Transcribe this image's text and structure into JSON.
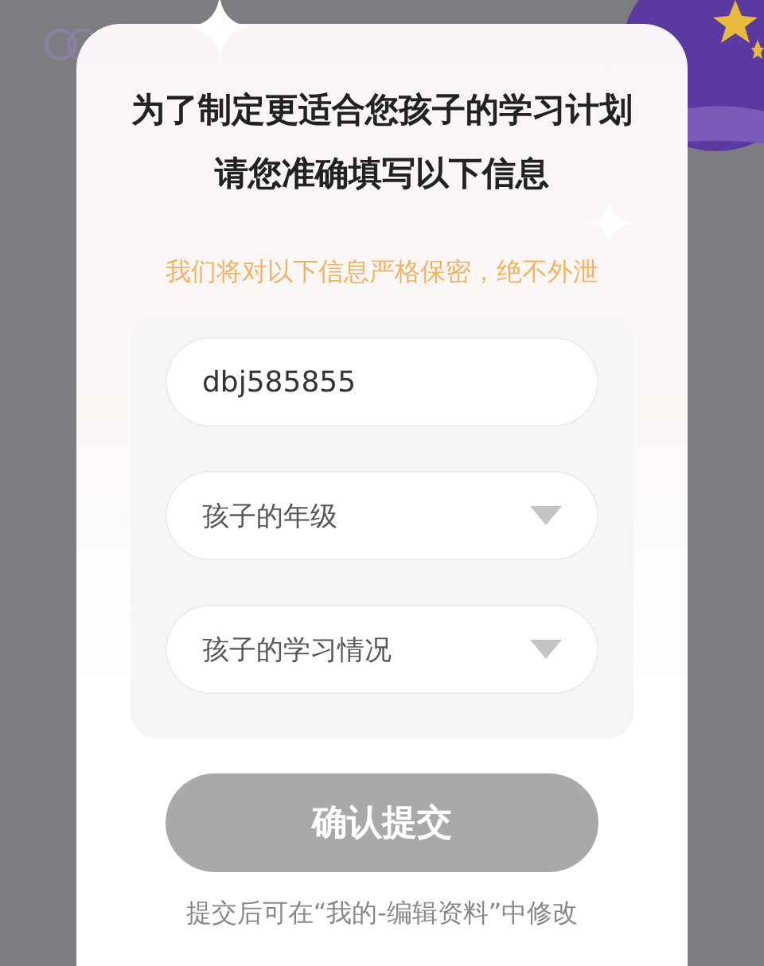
{
  "dialog": {
    "title_lines": [
      "为了制定更适合您孩子的学习计划",
      "请您准确填写以下信息"
    ],
    "notice": "我们将对以下信息严格保密，绝不外泄",
    "fields": [
      {
        "kind": "text",
        "value": "dbj585855"
      },
      {
        "kind": "dropdown",
        "placeholder": "孩子的年级"
      },
      {
        "kind": "dropdown",
        "placeholder": "孩子的学习情况"
      }
    ],
    "submit": {
      "label": "确认提交",
      "disabled": true
    },
    "footnote": "提交后可在“我的-编辑资料”中修改"
  }
}
